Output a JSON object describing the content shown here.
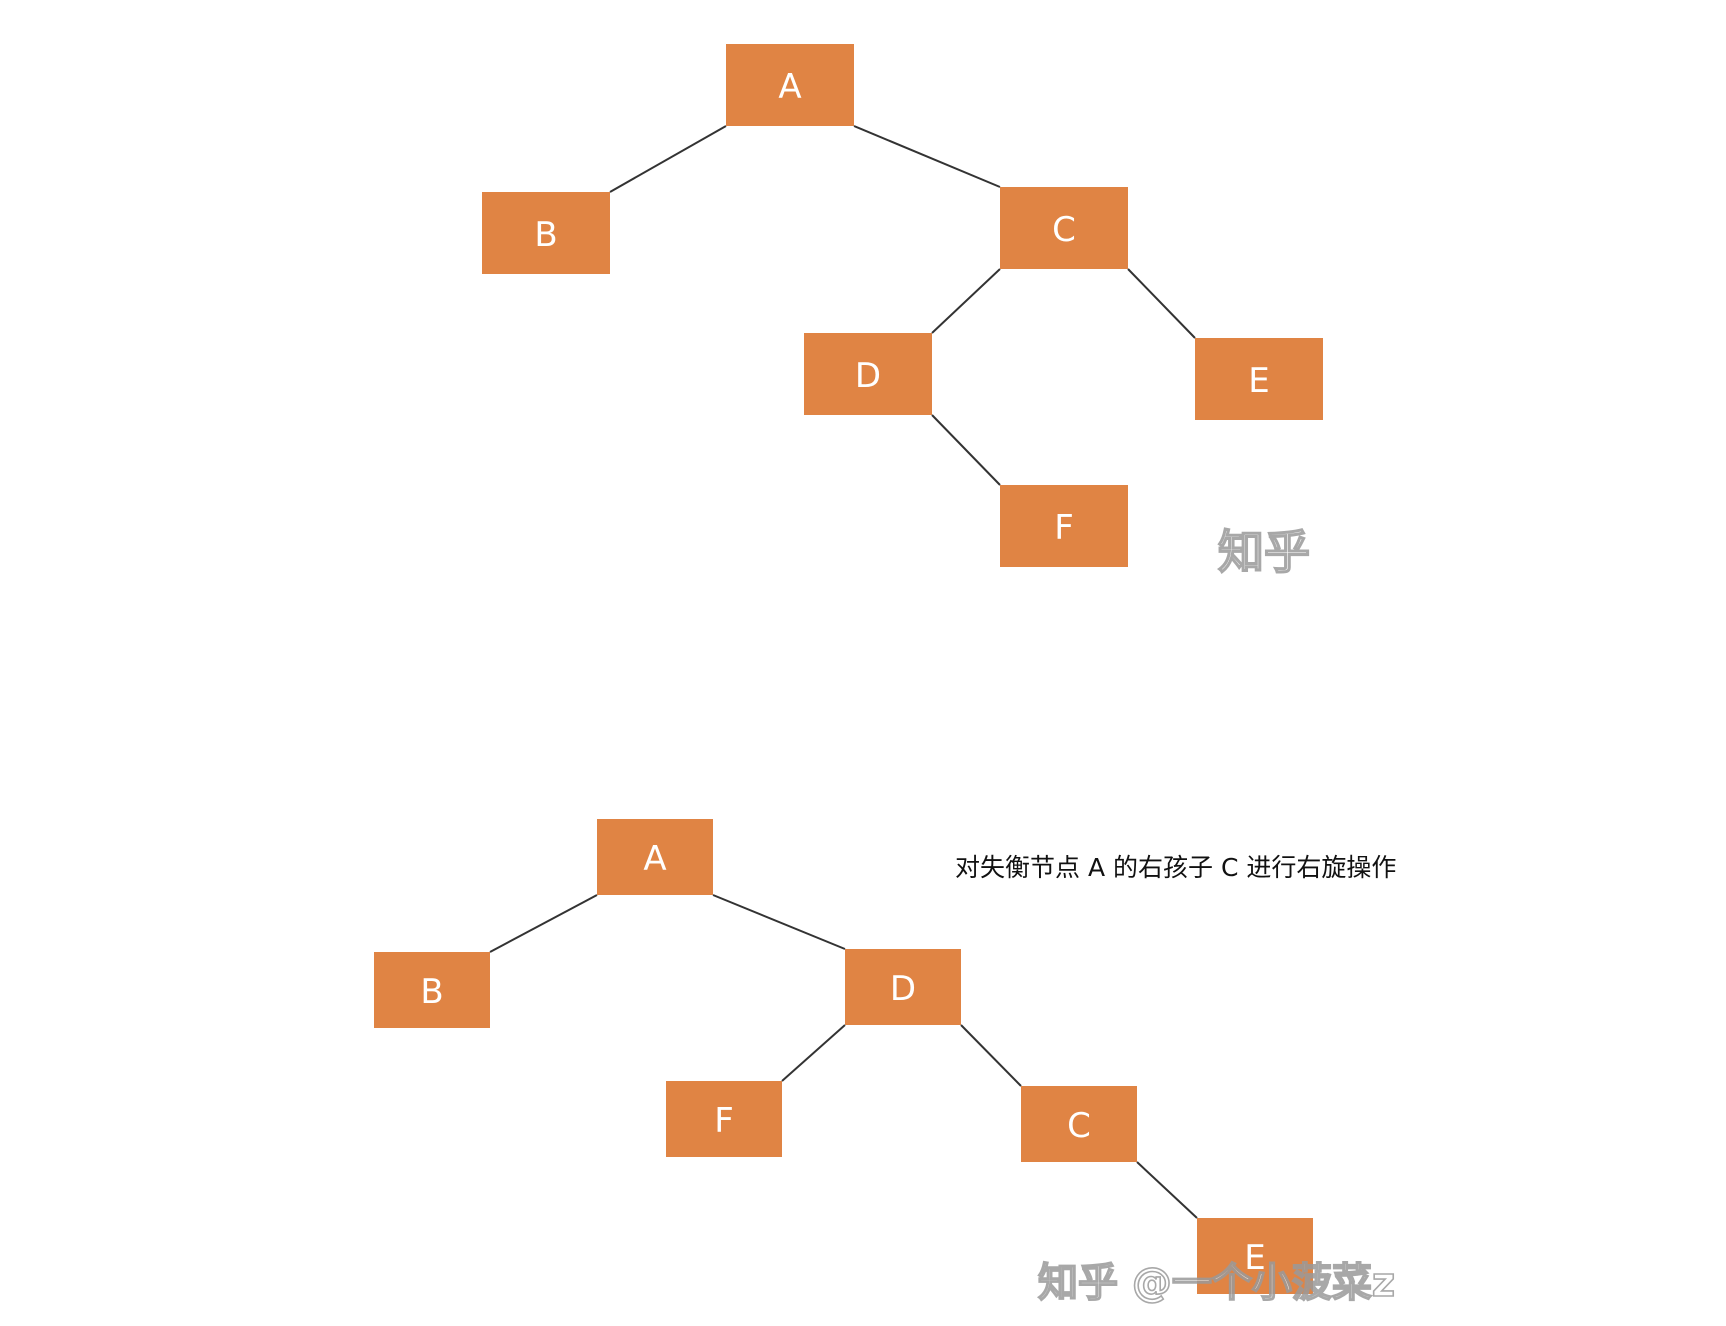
{
  "diagram": {
    "top_tree": {
      "nodes": [
        {
          "id": "A",
          "label": "A"
        },
        {
          "id": "B",
          "label": "B"
        },
        {
          "id": "C",
          "label": "C"
        },
        {
          "id": "D",
          "label": "D"
        },
        {
          "id": "E",
          "label": "E"
        },
        {
          "id": "F",
          "label": "F"
        }
      ],
      "edges": [
        [
          "A",
          "B"
        ],
        [
          "A",
          "C"
        ],
        [
          "C",
          "D"
        ],
        [
          "C",
          "E"
        ],
        [
          "D",
          "F"
        ]
      ]
    },
    "bottom_tree": {
      "nodes": [
        {
          "id": "A",
          "label": "A"
        },
        {
          "id": "B",
          "label": "B"
        },
        {
          "id": "D",
          "label": "D"
        },
        {
          "id": "F",
          "label": "F"
        },
        {
          "id": "C",
          "label": "C"
        },
        {
          "id": "E",
          "label": "E"
        }
      ],
      "edges": [
        [
          "A",
          "B"
        ],
        [
          "A",
          "D"
        ],
        [
          "D",
          "F"
        ],
        [
          "D",
          "C"
        ],
        [
          "C",
          "E"
        ]
      ]
    },
    "caption": "对失衡节点 A 的右孩子 C 进行右旋操作",
    "watermark_top": "知乎",
    "watermark_bottom": "知乎 @一个小菠菜z",
    "node_color": "#e08444",
    "node_text_color": "#ffffff",
    "edge_color": "#333333"
  }
}
